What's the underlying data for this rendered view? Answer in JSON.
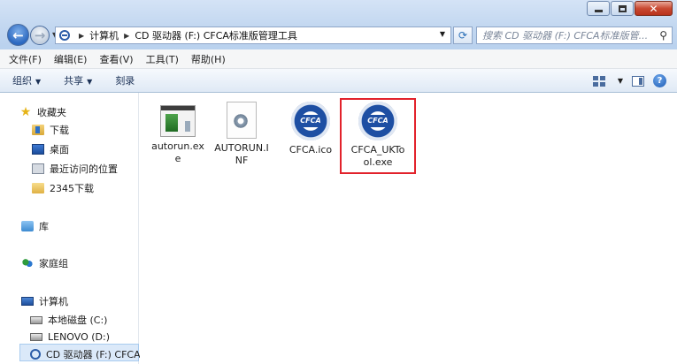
{
  "address": {
    "crumbs": [
      "计算机",
      "CD 驱动器 (F:) CFCA标准版管理工具"
    ]
  },
  "search": {
    "placeholder": "搜索 CD 驱动器 (F:) CFCA标准版管..."
  },
  "menu": [
    "文件(F)",
    "编辑(E)",
    "查看(V)",
    "工具(T)",
    "帮助(H)"
  ],
  "commands": {
    "organize": "组织",
    "share": "共享",
    "burn": "刻录"
  },
  "nav": {
    "favorites": "收藏夹",
    "downloads": "下载",
    "desktop": "桌面",
    "recent": "最近访问的位置",
    "folder2345": "2345下载",
    "libraries": "库",
    "homegroup": "家庭组",
    "computer": "计算机",
    "drive_c": "本地磁盘 (C:)",
    "drive_d": "LENOVO (D:)",
    "drive_f": "CD 驱动器 (F:) CFCA"
  },
  "files": [
    {
      "name": "autorun.exe",
      "type": "exe-icon"
    },
    {
      "name": "AUTORUN.INF",
      "type": "settings-file-icon"
    },
    {
      "name": "CFCA.ico",
      "type": "cfca-badge-icon"
    },
    {
      "name": "CFCA_UKTool.exe",
      "type": "cfca-badge-icon",
      "highlighted": true
    }
  ],
  "badge_text": "CFCA",
  "colors": {
    "highlight": "#e2222b",
    "selection": "#dbe9f9",
    "accent": "#1e4fa3"
  }
}
